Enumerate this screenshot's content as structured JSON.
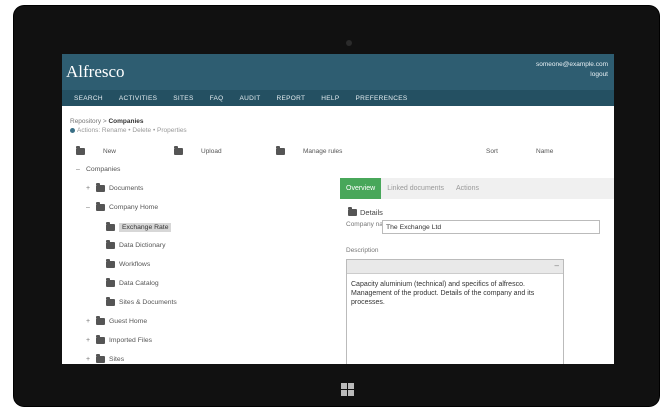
{
  "app": {
    "brand": "Alfresco"
  },
  "account": {
    "email": "someone@example.com",
    "logout": "logout"
  },
  "nav": [
    "SEARCH",
    "ACTIVITIES",
    "SITES",
    "FAQ",
    "AUDIT",
    "REPORT",
    "HELP",
    "PREFERENCES"
  ],
  "breadcrumb": {
    "path": "Repository > ",
    "current": "Companies"
  },
  "actions": {
    "text": "Actions: Rename • Delete • Properties"
  },
  "toolbar": {
    "new": "New",
    "upload": "Upload",
    "manage": "Manage rules",
    "sort": "Sort",
    "name": "Name"
  },
  "tree": [
    {
      "label": "Companies",
      "level": 0,
      "expander": "–",
      "folder": false
    },
    {
      "label": "Documents",
      "level": 1,
      "expander": "+",
      "folder": true
    },
    {
      "label": "Company Home",
      "level": 1,
      "expander": "–",
      "folder": true
    },
    {
      "label": "Exchange Rate",
      "level": 2,
      "expander": "",
      "folder": true,
      "selected": true
    },
    {
      "label": "Data Dictionary",
      "level": 2,
      "expander": "",
      "folder": true
    },
    {
      "label": "Workflows",
      "level": 2,
      "expander": "",
      "folder": true
    },
    {
      "label": "Data Catalog",
      "level": 2,
      "expander": "",
      "folder": true
    },
    {
      "label": "Sites & Documents",
      "level": 2,
      "expander": "",
      "folder": true
    },
    {
      "label": "Guest Home",
      "level": 1,
      "expander": "+",
      "folder": true
    },
    {
      "label": "Imported Files",
      "level": 1,
      "expander": "+",
      "folder": true
    },
    {
      "label": "Sites",
      "level": 1,
      "expander": "+",
      "folder": true
    }
  ],
  "detail": {
    "tabs": [
      "Overview",
      "Linked documents",
      "Actions"
    ],
    "folder_title": "Details",
    "field_label": "Company name *",
    "field_value": "The Exchange Ltd",
    "desc_label": "Description",
    "desc_text": "Capacity aluminium (technical) and specifics of alfresco. Management of the product. Details of the company and its processes."
  },
  "colors": {
    "header": "#2e5d71",
    "nav": "#245062",
    "active_tab": "#48a75a"
  }
}
